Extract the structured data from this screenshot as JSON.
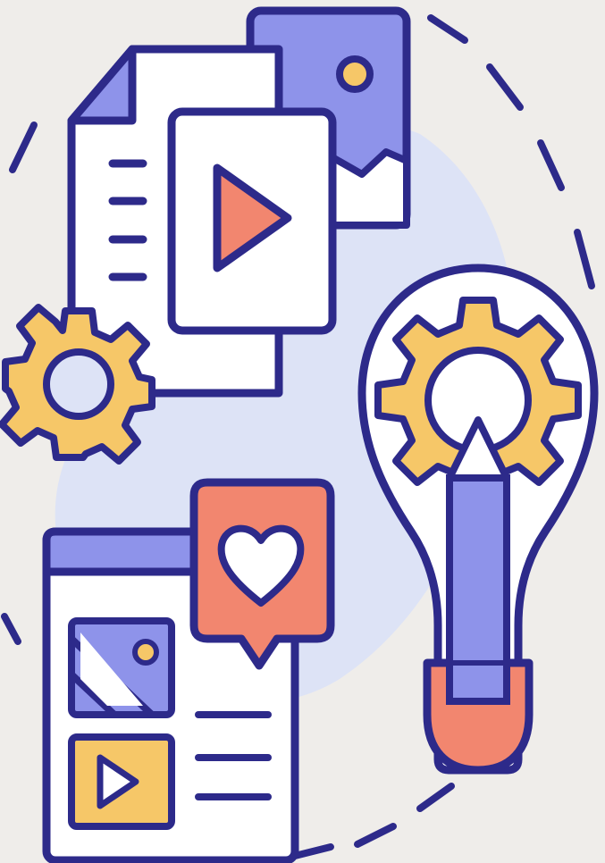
{
  "illustration": {
    "subject": "content-creation-icon",
    "elements": [
      "dashed-orbit",
      "document-icon",
      "image-card-icon",
      "video-card-icon",
      "gear-icon",
      "web-page-icon",
      "heart-speech-bubble-icon",
      "lightbulb-icon",
      "pencil-icon"
    ]
  },
  "colors": {
    "background": "#efedea",
    "outline": "#2d2a8a",
    "blob": "#dde3f6",
    "lavender": "#8e93ea",
    "peach": "#f2866f",
    "yellow": "#f6c768",
    "white": "#ffffff"
  }
}
